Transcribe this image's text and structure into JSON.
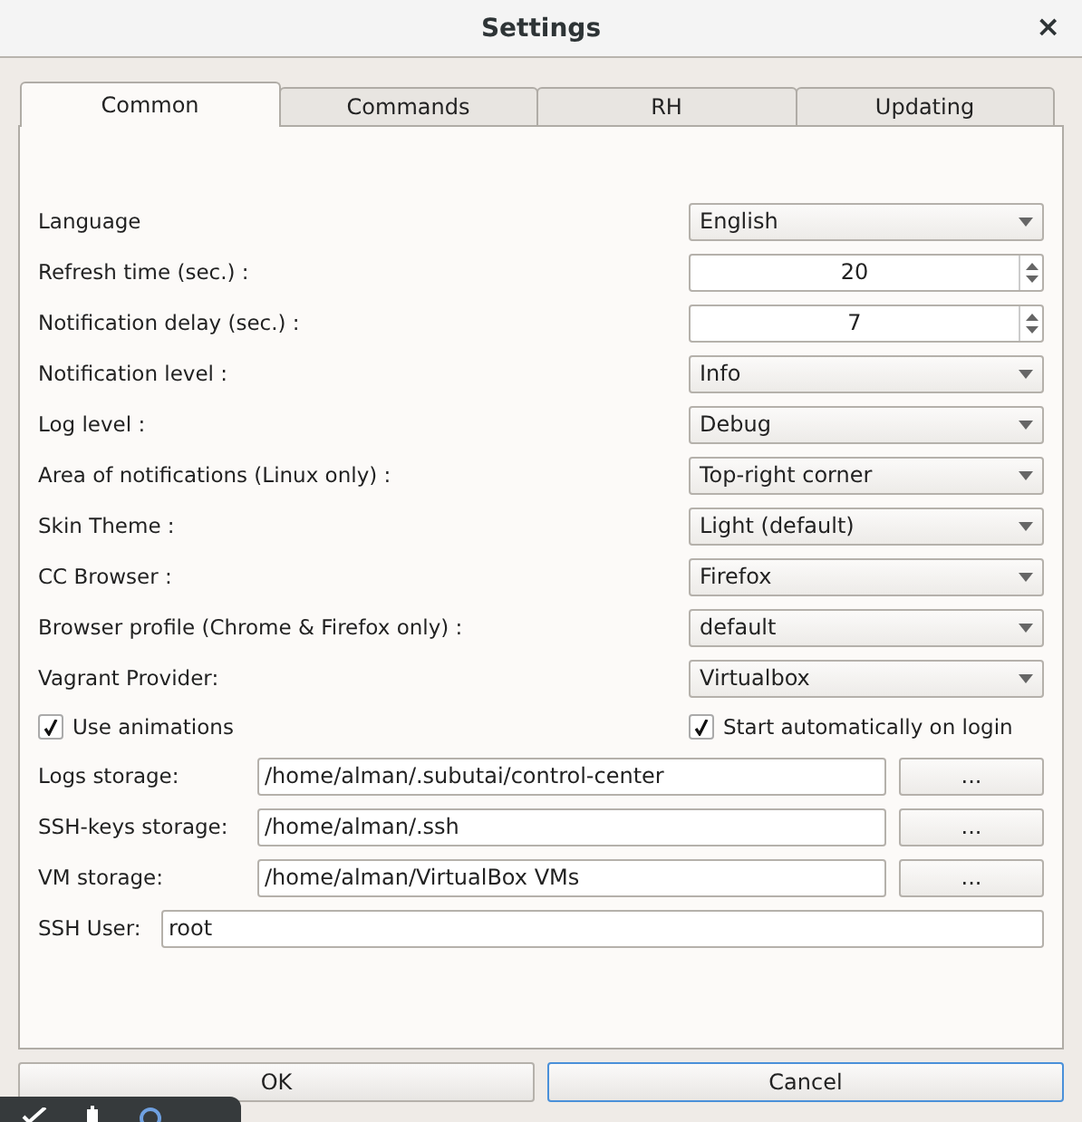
{
  "window": {
    "title": "Settings",
    "close": "×"
  },
  "tabs": [
    {
      "label": "Common",
      "selected": true
    },
    {
      "label": "Commands",
      "selected": false
    },
    {
      "label": "RH",
      "selected": false
    },
    {
      "label": "Updating",
      "selected": false
    }
  ],
  "settings": [
    {
      "label": "Language",
      "kind": "combo",
      "value": "English"
    },
    {
      "label": "Refresh time (sec.) :",
      "kind": "spin",
      "value": "20"
    },
    {
      "label": "Notification delay (sec.) :",
      "kind": "spin",
      "value": "7"
    },
    {
      "label": "Notification level :",
      "kind": "combo",
      "value": "Info"
    },
    {
      "label": "Log level :",
      "kind": "combo",
      "value": "Debug"
    },
    {
      "label": "Area of notifications (Linux only) :",
      "kind": "combo",
      "value": "Top-right corner"
    },
    {
      "label": "Skin Theme :",
      "kind": "combo",
      "value": "Light (default)"
    },
    {
      "label": "CC Browser :",
      "kind": "combo",
      "value": "Firefox"
    },
    {
      "label": "Browser profile (Chrome & Firefox only) :",
      "kind": "combo",
      "value": "default"
    },
    {
      "label": "Vagrant Provider:",
      "kind": "combo",
      "value": "Virtualbox"
    }
  ],
  "checkboxes": [
    {
      "label": "Use animations",
      "checked": true
    },
    {
      "label": "Start automatically on login",
      "checked": true
    }
  ],
  "paths": [
    {
      "label": "Logs storage:",
      "value": "/home/alman/.subutai/control-center",
      "button": "..."
    },
    {
      "label": "SSH-keys storage:",
      "value": "/home/alman/.ssh",
      "button": "..."
    },
    {
      "label": "VM storage:",
      "value": "/home/alman/VirtualBox VMs",
      "button": "..."
    }
  ],
  "ssh_user": {
    "label": "SSH User:",
    "value": "root"
  },
  "buttons": [
    {
      "label": "OK",
      "selected": false
    },
    {
      "label": "Cancel",
      "selected": true
    }
  ]
}
